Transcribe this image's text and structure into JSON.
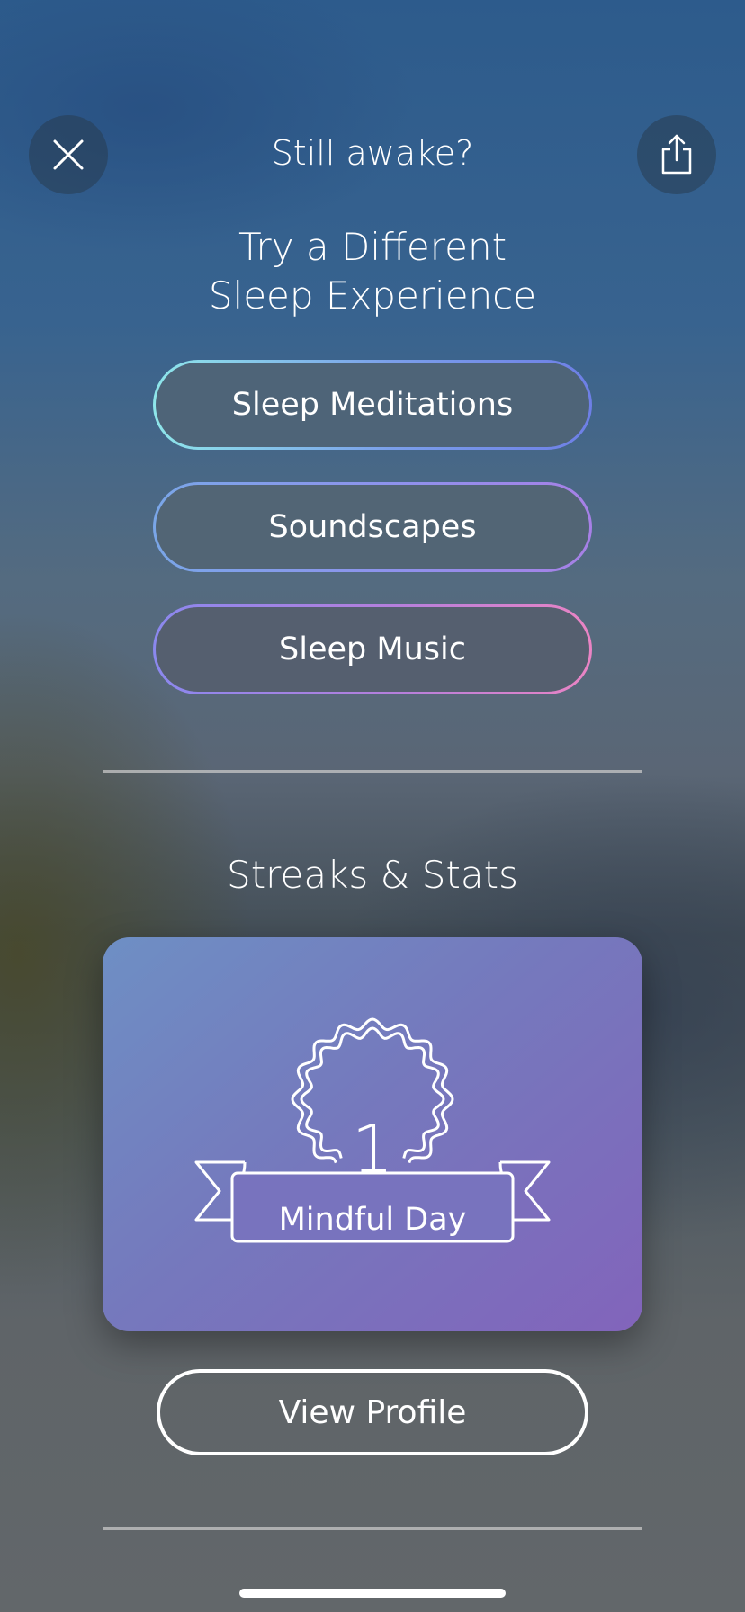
{
  "header": {
    "title": "Still awake?",
    "close_icon": "close-icon",
    "share_icon": "share-icon"
  },
  "sleep_section": {
    "title_line1": "Try a Different",
    "title_line2": "Sleep Experience",
    "options": [
      {
        "label": "Sleep Meditations"
      },
      {
        "label": "Soundscapes"
      },
      {
        "label": "Sleep Music"
      }
    ]
  },
  "stats_section": {
    "title": "Streaks & Stats",
    "badge": {
      "count": "1",
      "label": "Mindful Day",
      "icon": "award-ribbon-icon"
    },
    "view_profile_label": "View Profile"
  },
  "colors": {
    "card_gradient_start": "#6e8fc4",
    "card_gradient_end": "#8264bb",
    "pill_gradient_cyan": "#8ee6ea",
    "pill_gradient_violet": "#a780e6",
    "pill_gradient_pink": "#ea84c4"
  }
}
